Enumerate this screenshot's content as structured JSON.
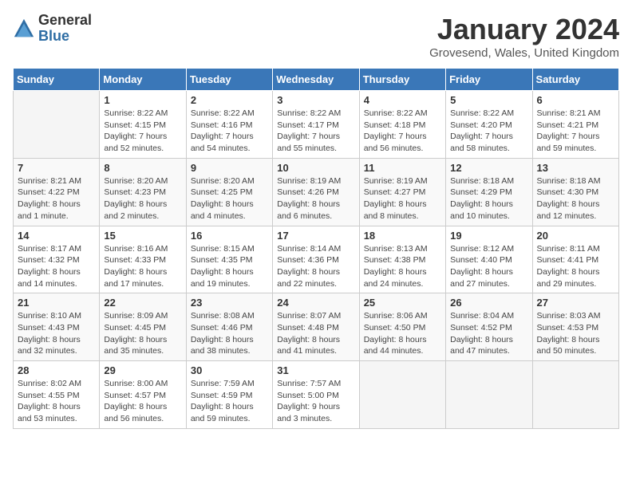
{
  "logo": {
    "general": "General",
    "blue": "Blue"
  },
  "title": "January 2024",
  "location": "Grovesend, Wales, United Kingdom",
  "days_of_week": [
    "Sunday",
    "Monday",
    "Tuesday",
    "Wednesday",
    "Thursday",
    "Friday",
    "Saturday"
  ],
  "weeks": [
    [
      {
        "day": "",
        "info": ""
      },
      {
        "day": "1",
        "info": "Sunrise: 8:22 AM\nSunset: 4:15 PM\nDaylight: 7 hours\nand 52 minutes."
      },
      {
        "day": "2",
        "info": "Sunrise: 8:22 AM\nSunset: 4:16 PM\nDaylight: 7 hours\nand 54 minutes."
      },
      {
        "day": "3",
        "info": "Sunrise: 8:22 AM\nSunset: 4:17 PM\nDaylight: 7 hours\nand 55 minutes."
      },
      {
        "day": "4",
        "info": "Sunrise: 8:22 AM\nSunset: 4:18 PM\nDaylight: 7 hours\nand 56 minutes."
      },
      {
        "day": "5",
        "info": "Sunrise: 8:22 AM\nSunset: 4:20 PM\nDaylight: 7 hours\nand 58 minutes."
      },
      {
        "day": "6",
        "info": "Sunrise: 8:21 AM\nSunset: 4:21 PM\nDaylight: 7 hours\nand 59 minutes."
      }
    ],
    [
      {
        "day": "7",
        "info": "Sunrise: 8:21 AM\nSunset: 4:22 PM\nDaylight: 8 hours\nand 1 minute."
      },
      {
        "day": "8",
        "info": "Sunrise: 8:20 AM\nSunset: 4:23 PM\nDaylight: 8 hours\nand 2 minutes."
      },
      {
        "day": "9",
        "info": "Sunrise: 8:20 AM\nSunset: 4:25 PM\nDaylight: 8 hours\nand 4 minutes."
      },
      {
        "day": "10",
        "info": "Sunrise: 8:19 AM\nSunset: 4:26 PM\nDaylight: 8 hours\nand 6 minutes."
      },
      {
        "day": "11",
        "info": "Sunrise: 8:19 AM\nSunset: 4:27 PM\nDaylight: 8 hours\nand 8 minutes."
      },
      {
        "day": "12",
        "info": "Sunrise: 8:18 AM\nSunset: 4:29 PM\nDaylight: 8 hours\nand 10 minutes."
      },
      {
        "day": "13",
        "info": "Sunrise: 8:18 AM\nSunset: 4:30 PM\nDaylight: 8 hours\nand 12 minutes."
      }
    ],
    [
      {
        "day": "14",
        "info": "Sunrise: 8:17 AM\nSunset: 4:32 PM\nDaylight: 8 hours\nand 14 minutes."
      },
      {
        "day": "15",
        "info": "Sunrise: 8:16 AM\nSunset: 4:33 PM\nDaylight: 8 hours\nand 17 minutes."
      },
      {
        "day": "16",
        "info": "Sunrise: 8:15 AM\nSunset: 4:35 PM\nDaylight: 8 hours\nand 19 minutes."
      },
      {
        "day": "17",
        "info": "Sunrise: 8:14 AM\nSunset: 4:36 PM\nDaylight: 8 hours\nand 22 minutes."
      },
      {
        "day": "18",
        "info": "Sunrise: 8:13 AM\nSunset: 4:38 PM\nDaylight: 8 hours\nand 24 minutes."
      },
      {
        "day": "19",
        "info": "Sunrise: 8:12 AM\nSunset: 4:40 PM\nDaylight: 8 hours\nand 27 minutes."
      },
      {
        "day": "20",
        "info": "Sunrise: 8:11 AM\nSunset: 4:41 PM\nDaylight: 8 hours\nand 29 minutes."
      }
    ],
    [
      {
        "day": "21",
        "info": "Sunrise: 8:10 AM\nSunset: 4:43 PM\nDaylight: 8 hours\nand 32 minutes."
      },
      {
        "day": "22",
        "info": "Sunrise: 8:09 AM\nSunset: 4:45 PM\nDaylight: 8 hours\nand 35 minutes."
      },
      {
        "day": "23",
        "info": "Sunrise: 8:08 AM\nSunset: 4:46 PM\nDaylight: 8 hours\nand 38 minutes."
      },
      {
        "day": "24",
        "info": "Sunrise: 8:07 AM\nSunset: 4:48 PM\nDaylight: 8 hours\nand 41 minutes."
      },
      {
        "day": "25",
        "info": "Sunrise: 8:06 AM\nSunset: 4:50 PM\nDaylight: 8 hours\nand 44 minutes."
      },
      {
        "day": "26",
        "info": "Sunrise: 8:04 AM\nSunset: 4:52 PM\nDaylight: 8 hours\nand 47 minutes."
      },
      {
        "day": "27",
        "info": "Sunrise: 8:03 AM\nSunset: 4:53 PM\nDaylight: 8 hours\nand 50 minutes."
      }
    ],
    [
      {
        "day": "28",
        "info": "Sunrise: 8:02 AM\nSunset: 4:55 PM\nDaylight: 8 hours\nand 53 minutes."
      },
      {
        "day": "29",
        "info": "Sunrise: 8:00 AM\nSunset: 4:57 PM\nDaylight: 8 hours\nand 56 minutes."
      },
      {
        "day": "30",
        "info": "Sunrise: 7:59 AM\nSunset: 4:59 PM\nDaylight: 8 hours\nand 59 minutes."
      },
      {
        "day": "31",
        "info": "Sunrise: 7:57 AM\nSunset: 5:00 PM\nDaylight: 9 hours\nand 3 minutes."
      },
      {
        "day": "",
        "info": ""
      },
      {
        "day": "",
        "info": ""
      },
      {
        "day": "",
        "info": ""
      }
    ]
  ]
}
